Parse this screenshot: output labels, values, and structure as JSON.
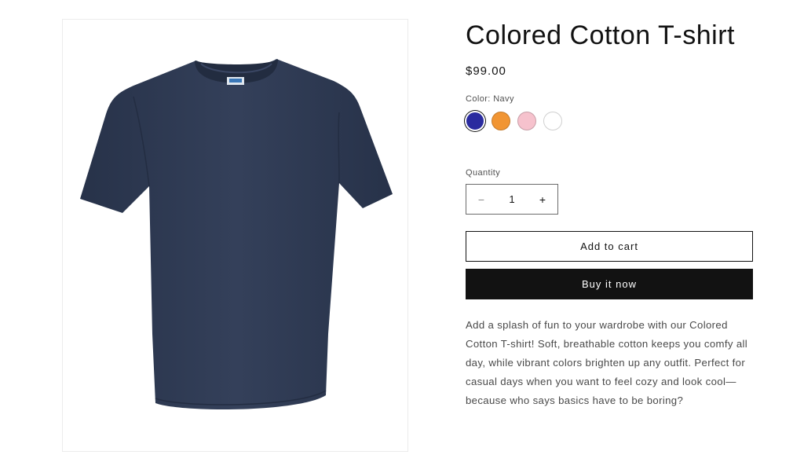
{
  "product": {
    "title": "Colored Cotton T-shirt",
    "price": "$99.00",
    "image_alt": "Navy cotton t-shirt",
    "color_label": "Color: Navy",
    "swatches": [
      {
        "name": "Navy",
        "color": "#2a2b9f",
        "selected": true
      },
      {
        "name": "Orange",
        "color": "#f19533",
        "selected": false
      },
      {
        "name": "Pink",
        "color": "#f6c2cd",
        "selected": false
      },
      {
        "name": "White",
        "color": "#ffffff",
        "selected": false
      }
    ],
    "quantity_label": "Quantity",
    "quantity": "1",
    "minus_symbol": "−",
    "plus_symbol": "+",
    "add_to_cart_label": "Add to cart",
    "buy_now_label": "Buy it now",
    "description": "Add a splash of fun to your wardrobe with our Colored Cotton T-shirt! Soft, breathable cotton keeps you comfy all day, while vibrant colors brighten up any outfit. Perfect for casual days when you want to feel cozy and look cool—because who says basics have to be boring?",
    "shirt_color": "#2e3a52"
  }
}
